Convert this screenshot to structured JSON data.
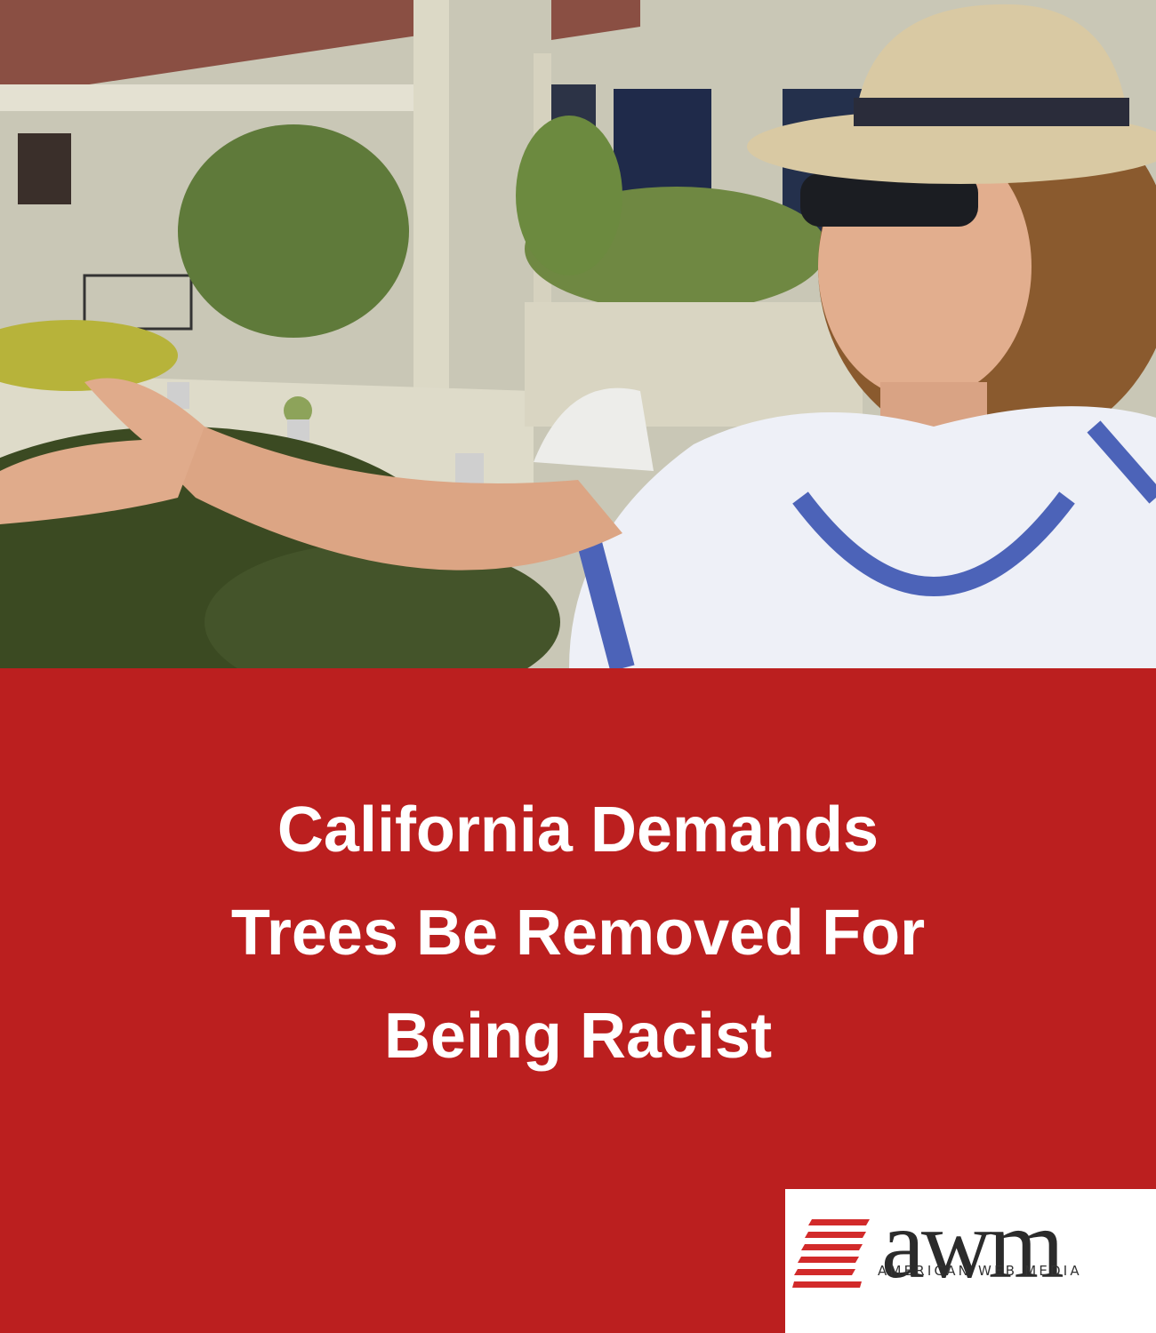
{
  "article": {
    "headline_lines": [
      "California Demands",
      "Trees Be Removed For",
      "Being Racist"
    ]
  },
  "photo": {
    "subject": "woman in straw hat and sunglasses gesturing toward hedges in front of a condominium complex"
  },
  "logo": {
    "wordmark": "awm",
    "tagline": "AMERICAN WEB MEDIA"
  },
  "colors": {
    "panel_red": "#BB1F1F",
    "logo_stripe_red": "#D22A2A",
    "logo_text": "#2b2b2b",
    "headline_text": "#FFFFFF"
  }
}
